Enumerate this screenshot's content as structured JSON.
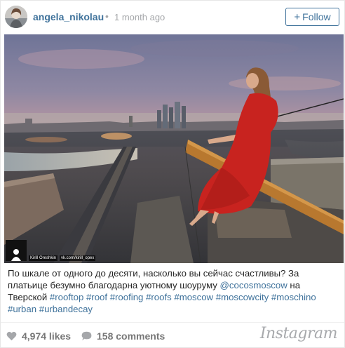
{
  "post": {
    "username": "angela_nikolau",
    "separator": "•",
    "time_ago": "1 month ago",
    "follow_label": "Follow",
    "follow_icon": "plus-icon"
  },
  "photo": {
    "credit_name": "Kirill Oreshkin",
    "credit_handle": "vk.com/kirill_opex"
  },
  "caption": {
    "text_1": "По шкале от одного до десяти, насколько вы сейчас счастливы? За платьице безумно благодарна уютному шоуруму ",
    "mention": "@cocosmoscow",
    "text_2": " на Тверской ",
    "hashtags": [
      "#rooftop",
      "#roof",
      "#roofing",
      "#roofs",
      "#moscow",
      "#moscowcity",
      "#moschino",
      "#urban",
      "#urbandecay"
    ]
  },
  "footer": {
    "likes": "4,974 likes",
    "comments": "158 comments",
    "brand": "Instagram"
  },
  "colors": {
    "link": "#3f729b",
    "muted": "#a5a7aa",
    "dress": "#c8231f"
  }
}
